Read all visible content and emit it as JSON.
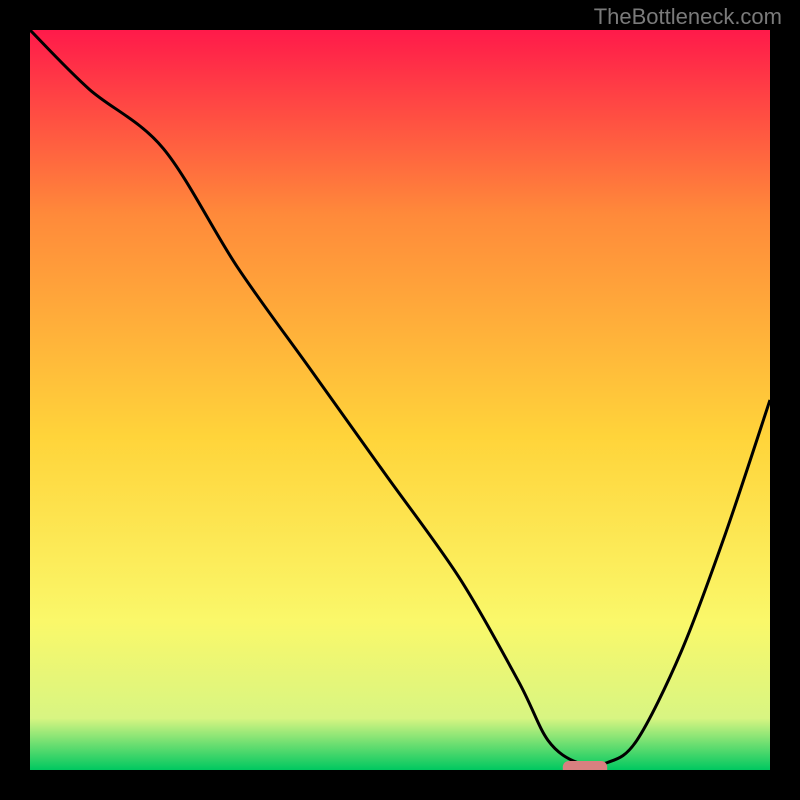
{
  "watermark": "TheBottleneck.com",
  "chart_data": {
    "type": "line",
    "title": "",
    "xlabel": "",
    "ylabel": "",
    "xlim": [
      0,
      100
    ],
    "ylim": [
      0,
      100
    ],
    "background_gradient": {
      "top": "#ff1a4a",
      "upper_mid": "#ff8a3a",
      "mid": "#ffd43a",
      "lower_mid": "#faf86a",
      "near_bottom": "#d8f582",
      "bottom": "#00c860"
    },
    "series": [
      {
        "name": "bottleneck-curve",
        "color": "#000000",
        "x": [
          0,
          8,
          18,
          28,
          38,
          48,
          58,
          66,
          70,
          74,
          78,
          82,
          88,
          94,
          100
        ],
        "values": [
          100,
          92,
          84,
          68,
          54,
          40,
          26,
          12,
          4,
          1,
          1,
          4,
          16,
          32,
          50
        ]
      }
    ],
    "marker": {
      "name": "optimal-range",
      "color": "#d88080",
      "x_start": 72,
      "x_end": 78,
      "y": 0
    }
  }
}
